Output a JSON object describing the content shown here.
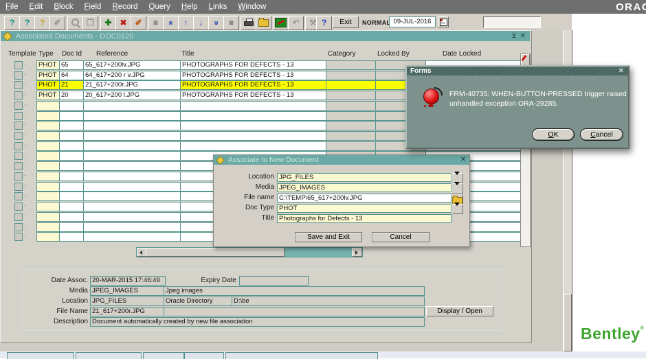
{
  "menu_bar": {
    "items": [
      "File",
      "Edit",
      "Block",
      "Field",
      "Record",
      "Query",
      "Help",
      "Links",
      "Window"
    ],
    "brand": "ORACLE"
  },
  "toolbar": {
    "exit_label": "Exit",
    "mode_label": "NORMAL",
    "date_value": "09-JUL-2016",
    "icons": [
      {
        "name": "enter-query-icon",
        "glyph": "?",
        "color": "#0a8f86"
      },
      {
        "name": "execute-query-icon",
        "glyph": "?",
        "color": "#0a8f86"
      },
      {
        "name": "cancel-query-icon",
        "glyph": "?",
        "color": "#bfa11c"
      },
      {
        "name": "clear-field-icon",
        "glyph": "✐",
        "color": "#9b988f",
        "disabled": true
      },
      {
        "name": "find-icon",
        "kind": "mag",
        "disabled": true
      },
      {
        "name": "new-record-icon",
        "glyph": "❒",
        "color": "#9b988f",
        "disabled": true
      },
      {
        "name": "insert-record-icon",
        "glyph": "✚",
        "color": "#157a15"
      },
      {
        "name": "delete-record-icon",
        "glyph": "✖",
        "color": "#bf1d1d"
      },
      {
        "name": "clear-record-icon",
        "glyph": "✐",
        "color": "#bf5a1d"
      },
      {
        "name": "previous-block-icon",
        "glyph": "≡",
        "color": "#2e2e2e"
      },
      {
        "name": "scroll-up-icon",
        "glyph": "«",
        "color": "#1f3db8",
        "kind": "rot90"
      },
      {
        "name": "previous-record-icon",
        "glyph": "↑",
        "color": "#1f3db8"
      },
      {
        "name": "next-record-icon",
        "glyph": "↓",
        "color": "#1f3db8"
      },
      {
        "name": "scroll-down-icon",
        "glyph": "«",
        "color": "#1f3db8",
        "kind": "rot270"
      },
      {
        "name": "next-block-icon",
        "glyph": "≡",
        "color": "#2e2e2e"
      },
      {
        "name": "print-icon",
        "kind": "printer"
      },
      {
        "name": "save-icon",
        "kind": "folder"
      },
      {
        "name": "commit-icon",
        "kind": "commit"
      },
      {
        "name": "rollback-icon",
        "glyph": "↶",
        "color": "#9b988f",
        "disabled": true
      },
      {
        "name": "tools-icon",
        "glyph": "⚒",
        "color": "#9b988f",
        "disabled": true
      },
      {
        "name": "help-icon",
        "glyph": "?",
        "color": "#1f3db8"
      }
    ]
  },
  "window_info": {
    "title": "Associated Documents - DOC0120",
    "restore_glyph": "⊻",
    "close_glyph": "✕"
  },
  "table": {
    "headers": [
      "Template",
      "Type",
      "Doc Id",
      "Reference",
      "Title",
      "Category",
      "Locked By",
      "Date Locked"
    ],
    "rows": [
      {
        "type": "PHOT",
        "doc_id": "65",
        "reference": "65_617+200lv.JPG",
        "title": "PHOTOGRAPHS FOR DEFECTS - 13",
        "category": "",
        "locked_by": "",
        "date_locked": "",
        "highlighted": false
      },
      {
        "type": "PHOT",
        "doc_id": "64",
        "reference": "64_617+200 r v.JPG",
        "title": "PHOTOGRAPHS FOR DEFECTS - 13",
        "category": "",
        "locked_by": "",
        "date_locked": "",
        "highlighted": false
      },
      {
        "type": "PHOT",
        "doc_id": "21",
        "reference": "21_617+200r.JPG",
        "title": "PHOTOGRAPHS FOR DEFECTS - 13",
        "category": "",
        "locked_by": "",
        "date_locked": "",
        "highlighted": true
      },
      {
        "type": "PHOT",
        "doc_id": "20",
        "reference": "20_617+200 l.JPG",
        "title": "PHOTOGRAPHS FOR DEFECTS - 13",
        "category": "",
        "locked_by": "",
        "date_locked": "",
        "highlighted": false
      }
    ],
    "empty_row_count": 14
  },
  "detail_panel": {
    "date_assoc_label": "Date Assoc.",
    "date_assoc_value": "20-MAR-2015 17:46:49",
    "expiry_date_label": "Expiry Date",
    "expiry_date_value": "",
    "media_label": "Media",
    "media_code": "JPEG_IMAGES",
    "media_desc": "Jpeg images",
    "location_label": "Location",
    "location_code": "JPG_FILES",
    "location_type": "Oracle Directory",
    "location_path": "D:\\be",
    "file_name_label": "File Name",
    "file_name_value": "21_617+200r.JPG",
    "file_name_extra": "",
    "description_label": "Description",
    "description_value": "Document automatically created by new file association",
    "display_open_label": "Display / Open"
  },
  "assoc_dialog": {
    "title": "Associate to New Document",
    "close_glyph": "✕",
    "fields": [
      {
        "name": "location",
        "label": "Location",
        "value": "JPG_FILES",
        "bg": "cream",
        "button": "lov"
      },
      {
        "name": "media",
        "label": "Media",
        "value": "JPEG_IMAGES",
        "bg": "cream",
        "button": "lov"
      },
      {
        "name": "file-name",
        "label": "File name",
        "value": "C:\\TEMP\\65_617+200lv.JPG",
        "bg": "white",
        "button": "folder"
      },
      {
        "name": "doc-type",
        "label": "Doc Type",
        "value": "PHOT",
        "bg": "cream",
        "button": "lov"
      },
      {
        "name": "title",
        "label": "Title",
        "value": "Photographs for Defects - 13",
        "bg": "cream",
        "button": "none"
      }
    ],
    "save_exit_label": "Save and Exit",
    "cancel_label": "Cancel"
  },
  "error_dialog": {
    "title": "Forms",
    "close_glyph": "✕",
    "message_line1": "FRM-40735: WHEN-BUTTON-PRESSED trigger raised",
    "message_line2": "unhandled exception ORA-29285.",
    "ok_label": "OK",
    "cancel_label": "Cancel"
  },
  "branding": {
    "logo_text": "Bentley",
    "reg_mark": "®"
  },
  "colors": {
    "titlebar_teal": "#6aa9a5",
    "highlight_yellow": "#ffff00",
    "field_cream": "#fdfad2",
    "error_body": "#7d928c",
    "error_titlebar": "#42605a",
    "bentley_green": "#3ea52f"
  }
}
